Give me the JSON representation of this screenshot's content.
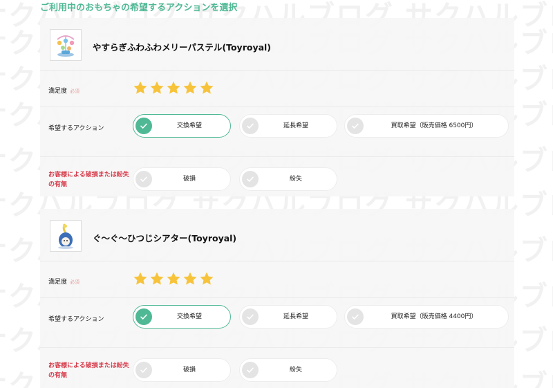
{
  "page": {
    "heading": "ご利用中のおもちゃの希望するアクションを選択"
  },
  "watermark_text": "サクハルブログ",
  "labels": {
    "satisfaction": "満足度",
    "satisfaction_hint": "必須",
    "desired_action": "希望するアクション",
    "damage_line1": "お客様による破損または紛失",
    "damage_line2": "の有無"
  },
  "colors": {
    "accent": "#4fb895",
    "star": "#f7c33a",
    "warning_text": "#d63b4a"
  },
  "products": [
    {
      "name": "やすらぎふわふわメリーパステル(Toyroyal)",
      "thumbnail_icon": "merry-toy-icon",
      "rating": 5,
      "actions": [
        {
          "label": "交換希望",
          "selected": true
        },
        {
          "label": "延長希望",
          "selected": false
        },
        {
          "label": "買取希望（販売価格 6500円）",
          "selected": false
        }
      ],
      "damage_options": [
        {
          "label": "破損",
          "selected": false
        },
        {
          "label": "紛失",
          "selected": false
        }
      ]
    },
    {
      "name": "ぐ〜ぐ〜ひつじシアター(Toyroyal)",
      "thumbnail_icon": "sheep-theater-toy-icon",
      "rating": 5,
      "actions": [
        {
          "label": "交換希望",
          "selected": true
        },
        {
          "label": "延長希望",
          "selected": false
        },
        {
          "label": "買取希望（販売価格 4400円）",
          "selected": false
        }
      ],
      "damage_options": [
        {
          "label": "破損",
          "selected": false
        },
        {
          "label": "紛失",
          "selected": false
        }
      ]
    }
  ]
}
